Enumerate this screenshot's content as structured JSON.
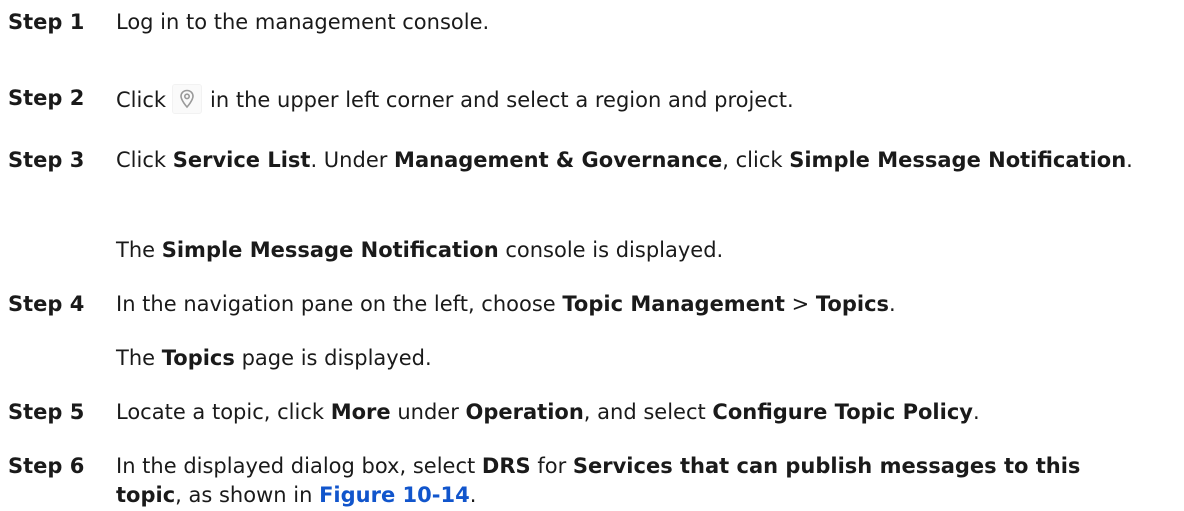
{
  "steps": [
    {
      "label": "Step 1",
      "t1": "Log in to the management console."
    },
    {
      "label": "Step 2",
      "t1": "Click",
      "icon": "location-pin-icon",
      "t2": "in the upper left corner and select a region and project."
    },
    {
      "label": "Step 3",
      "t1": "Click ",
      "b1": "Service List",
      "t2": ". Under ",
      "b2": "Management & Governance",
      "t3": ", click ",
      "b3": "Simple Message Notification",
      "t4": "."
    },
    {
      "label": "",
      "t1": "The ",
      "b1": "Simple Message Notification",
      "t2": " console is displayed."
    },
    {
      "label": "Step 4",
      "t1": "In the navigation pane on the left, choose ",
      "b1": "Topic Management",
      "t2": " > ",
      "b2": "Topics",
      "t3": "."
    },
    {
      "label": "",
      "t1": "The ",
      "b1": "Topics",
      "t2": " page is displayed."
    },
    {
      "label": "Step 5",
      "t1": "Locate a topic, click ",
      "b1": "More",
      "t2": " under ",
      "b2": "Operation",
      "t3": ", and select ",
      "b3": "Configure Topic Policy",
      "t4": "."
    },
    {
      "label": "Step 6",
      "t1": "In the displayed dialog box, select ",
      "b1": "DRS",
      "t2": " for ",
      "b2": "Services that can publish messages to this topic",
      "t3": ", as shown in ",
      "link": "Figure 10-14",
      "t4": "."
    }
  ]
}
